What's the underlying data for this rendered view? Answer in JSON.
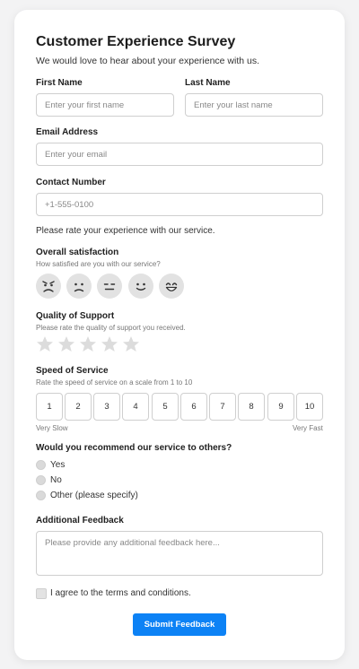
{
  "form": {
    "title": "Customer Experience Survey",
    "subtitle": "We would love to hear about your experience with us.",
    "first_name": {
      "label": "First Name",
      "placeholder": "Enter your first name"
    },
    "last_name": {
      "label": "Last Name",
      "placeholder": "Enter your last name"
    },
    "email": {
      "label": "Email Address",
      "placeholder": "Enter your email"
    },
    "contact": {
      "label": "Contact Number",
      "placeholder": "+1-555-0100"
    },
    "rating_intro": "Please rate your experience with our service.",
    "satisfaction": {
      "label": "Overall satisfaction",
      "hint": "How satisfied are you with our service?",
      "faces": [
        "angry-face-icon",
        "sad-face-icon",
        "neutral-face-icon",
        "smile-face-icon",
        "grin-face-icon"
      ]
    },
    "support": {
      "label": "Quality of Support",
      "hint": "Please rate the quality of support you received.",
      "stars_total": 5,
      "stars_selected": 0
    },
    "speed": {
      "label": "Speed of Service",
      "hint": "Rate the speed of service on a scale from 1 to 10",
      "options": [
        "1",
        "2",
        "3",
        "4",
        "5",
        "6",
        "7",
        "8",
        "9",
        "10"
      ],
      "min_label": "Very Slow",
      "max_label": "Very Fast"
    },
    "recommend": {
      "label": "Would you recommend our service to others?",
      "options": [
        "Yes",
        "No",
        "Other (please specify)"
      ]
    },
    "feedback": {
      "label": "Additional Feedback",
      "placeholder": "Please provide any additional feedback here..."
    },
    "terms_label": "I agree to the terms and conditions.",
    "submit_label": "Submit Feedback"
  },
  "colors": {
    "accent": "#0d82f5",
    "background": "#f3f3f4",
    "card": "#ffffff",
    "control_fill": "#e2e2e2"
  }
}
